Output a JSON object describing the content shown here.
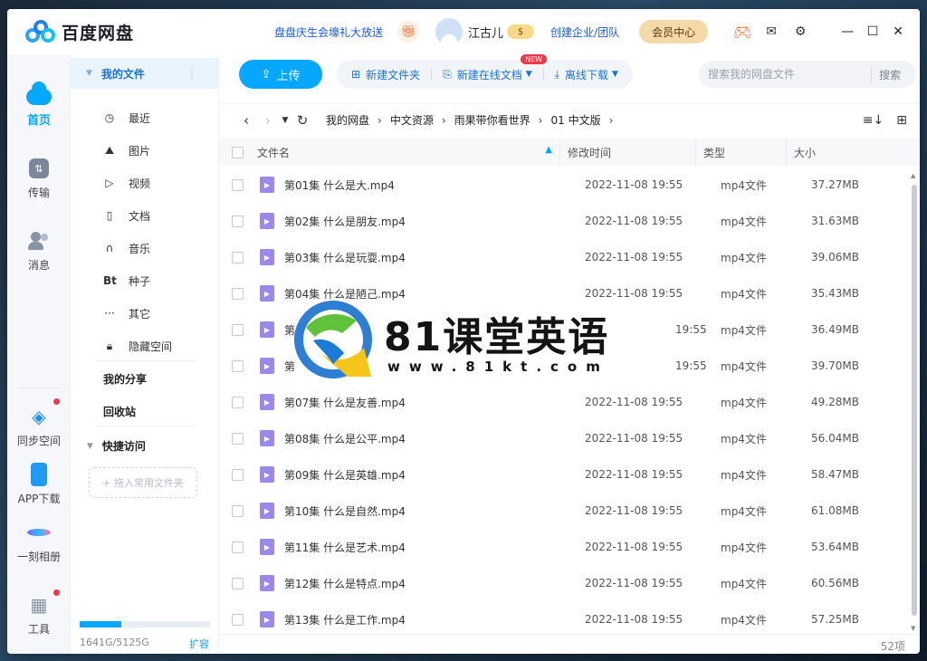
{
  "app": {
    "logo_text": "百度网盘",
    "promo_link": "盘盘庆生会壕礼大放送",
    "username": "江古儿",
    "coin_label": "$",
    "enterprise_link": "创建企业/团队",
    "vip_button": "会员中心"
  },
  "leftnav": {
    "home": "首页",
    "transfer": "传输",
    "messages": "消息",
    "sync": "同步空间",
    "app_download": "APP下载",
    "album": "一刻相册",
    "tools": "工具"
  },
  "sidebar": {
    "my_files": "我的文件",
    "items": [
      {
        "icon": "clock-icon",
        "glyph": "◷",
        "label": "最近"
      },
      {
        "icon": "image-icon",
        "glyph": "⛰",
        "label": "图片"
      },
      {
        "icon": "play-icon",
        "glyph": "▷",
        "label": "视频"
      },
      {
        "icon": "document-icon",
        "glyph": "▯",
        "label": "文档"
      },
      {
        "icon": "headphones-icon",
        "glyph": "∩",
        "label": "音乐"
      },
      {
        "icon": "bt-icon",
        "glyph": "Bt",
        "label": "种子"
      },
      {
        "icon": "more-icon",
        "glyph": "···",
        "label": "其它"
      },
      {
        "icon": "lock-icon",
        "glyph": "🔒︎",
        "label": "隐藏空间"
      }
    ],
    "my_share": "我的分享",
    "recycle_bin": "回收站",
    "quick_access": "快捷访问",
    "dropzone": "+ 拖入常用文件夹",
    "quota_text": "1641G/5125G",
    "quota_fraction": 0.32,
    "expand": "扩容"
  },
  "toolbar": {
    "upload": "上传",
    "new_folder": "新建文件夹",
    "new_online_doc": "新建在线文档",
    "new_badge": "NEW",
    "offline_download": "离线下载",
    "search_placeholder": "搜索我的网盘文件",
    "search_button": "搜索"
  },
  "breadcrumb": [
    "我的网盘",
    "中文资源",
    "雨果带你看世界",
    "01 中文版"
  ],
  "table": {
    "headers": {
      "name": "文件名",
      "time": "修改时间",
      "type": "类型",
      "size": "大小"
    },
    "rows": [
      {
        "name": "第01集 什么是大.mp4",
        "time": "2022-11-08 19:55",
        "type": "mp4文件",
        "size": "37.27MB"
      },
      {
        "name": "第02集 什么是朋友.mp4",
        "time": "2022-11-08 19:55",
        "type": "mp4文件",
        "size": "31.63MB"
      },
      {
        "name": "第03集 什么是玩耍.mp4",
        "time": "2022-11-08 19:55",
        "type": "mp4文件",
        "size": "39.06MB"
      },
      {
        "name": "第04集 什么是陋己.mp4",
        "time": "2022-11-08 19:55",
        "type": "mp4文件",
        "size": "35.43MB"
      },
      {
        "name": "第",
        "time": "19:55",
        "type": "mp4文件",
        "size": "36.49MB"
      },
      {
        "name": "第",
        "time": "19:55",
        "type": "mp4文件",
        "size": "39.70MB"
      },
      {
        "name": "第07集 什么是友善.mp4",
        "time": "2022-11-08 19:55",
        "type": "mp4文件",
        "size": "49.28MB"
      },
      {
        "name": "第08集 什么是公平.mp4",
        "time": "2022-11-08 19:55",
        "type": "mp4文件",
        "size": "56.04MB"
      },
      {
        "name": "第09集 什么是英雄.mp4",
        "time": "2022-11-08 19:55",
        "type": "mp4文件",
        "size": "58.47MB"
      },
      {
        "name": "第10集 什么是自然.mp4",
        "time": "2022-11-08 19:55",
        "type": "mp4文件",
        "size": "61.08MB"
      },
      {
        "name": "第11集 什么是艺术.mp4",
        "time": "2022-11-08 19:55",
        "type": "mp4文件",
        "size": "53.64MB"
      },
      {
        "name": "第12集 什么是特点.mp4",
        "time": "2022-11-08 19:55",
        "type": "mp4文件",
        "size": "60.56MB"
      },
      {
        "name": "第13集 什么是工作.mp4",
        "time": "2022-11-08 19:55",
        "type": "mp4文件",
        "size": "57.25MB"
      }
    ]
  },
  "footer": {
    "count": "52项"
  },
  "watermark": {
    "title": "81课堂英语",
    "url": "www.81kt.com"
  },
  "colors": {
    "accent": "#06a7ff",
    "link": "#1a5bd6",
    "video_icon": "#9b88e8"
  }
}
